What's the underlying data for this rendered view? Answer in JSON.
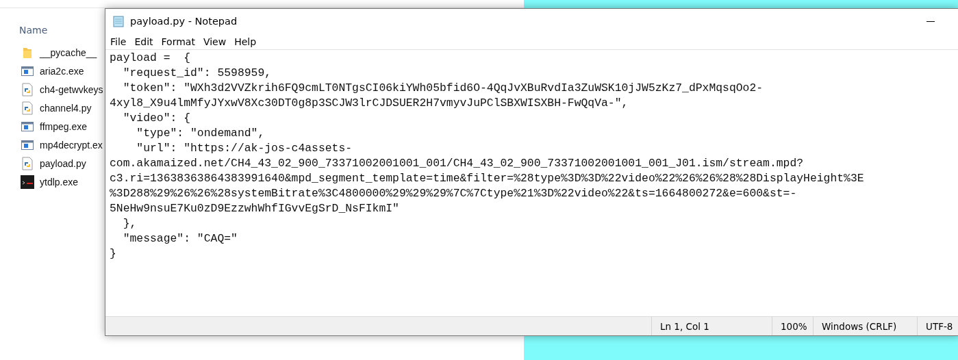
{
  "explorer": {
    "column_header": "Name",
    "files": [
      {
        "name": "__pycache__",
        "kind": "folder"
      },
      {
        "name": "aria2c.exe",
        "kind": "exe"
      },
      {
        "name": "ch4-getwvkeys",
        "kind": "python"
      },
      {
        "name": "channel4.py",
        "kind": "python"
      },
      {
        "name": "ffmpeg.exe",
        "kind": "exe"
      },
      {
        "name": "mp4decrypt.ex",
        "kind": "exe"
      },
      {
        "name": "payload.py",
        "kind": "python"
      },
      {
        "name": "ytdlp.exe",
        "kind": "terminal"
      }
    ]
  },
  "notepad": {
    "title": "payload.py - Notepad",
    "menu": [
      "File",
      "Edit",
      "Format",
      "View",
      "Help"
    ],
    "lines": [
      "payload =  {",
      "  \"request_id\": 5598959,",
      "  \"token\": \"WXh3d2VVZkrih6FQ9cmLT0NTgsCI06kiYWh05bfid6O-4QqJvXBuRvdIa3ZuWSK10jJW5zKz7_dPxMqsqOo2-",
      "4xyl8_X9u4lmMfyJYxwV8Xc30DT0g8p3SCJW3lrCJDSUER2H7vmyvJuPClSBXWISXBH-FwQqVa-\",",
      "  \"video\": {",
      "    \"type\": \"ondemand\",",
      "    \"url\": \"https://ak-jos-c4assets-",
      "com.akamaized.net/CH4_43_02_900_73371002001001_001/CH4_43_02_900_73371002001001_001_J01.ism/stream.mpd?",
      "c3.ri=13638363864383991640&mpd_segment_template=time&filter=%28type%3D%3D%22video%22%26%26%28%28DisplayHeight%3E",
      "%3D288%29%26%26%28systemBitrate%3C4800000%29%29%29%7C%7Ctype%21%3D%22video%22&ts=1664800272&e=600&st=-",
      "5NeHw9nsuE7Ku0zD9EzzwhWhfIGvvEgSrD_NsFIkmI\"",
      "  },",
      "  \"message\": \"CAQ=\"",
      "}"
    ],
    "status": [
      "Ln 1, Col 1",
      "100%",
      "Windows (CRLF)",
      "UTF-8"
    ]
  }
}
